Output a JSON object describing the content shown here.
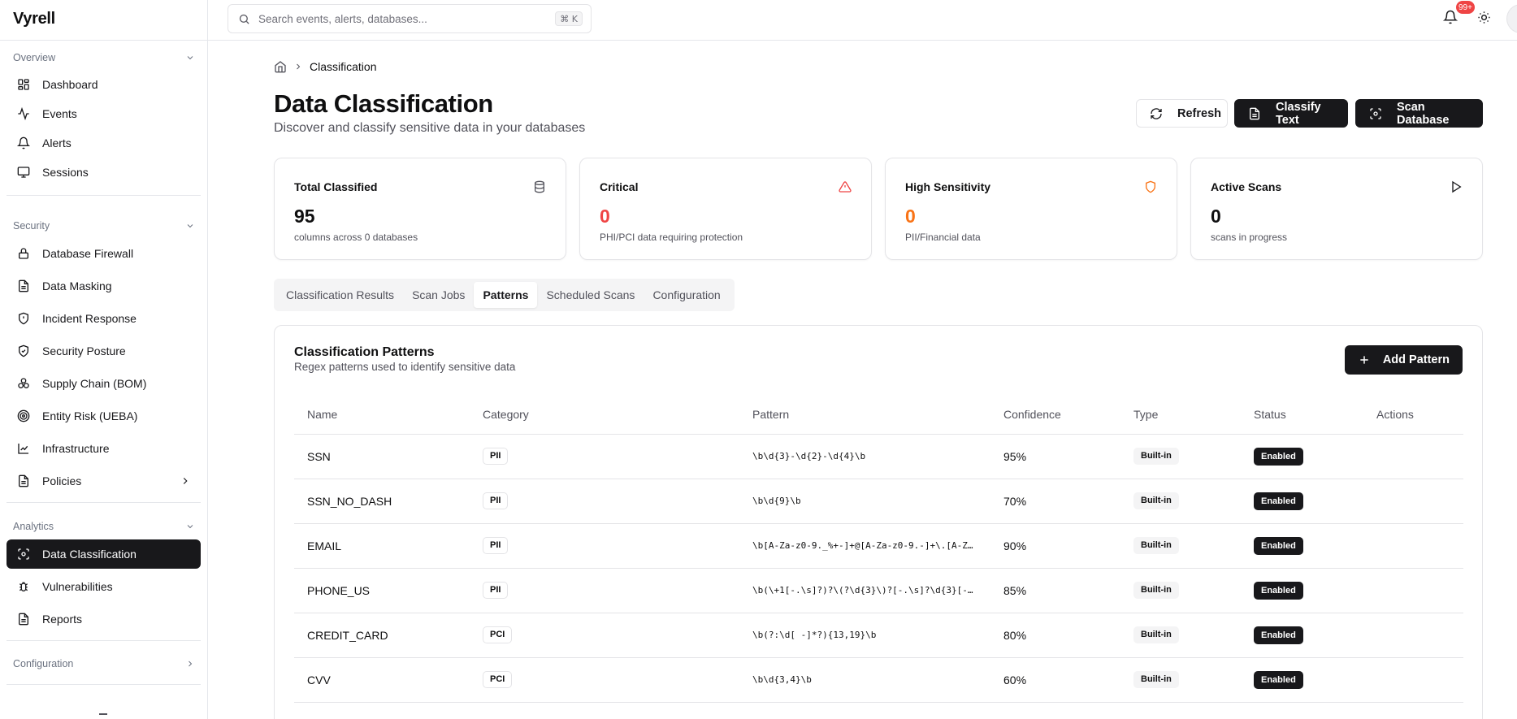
{
  "app": {
    "name": "Vyrell"
  },
  "search": {
    "placeholder": "Search events, alerts, databases...",
    "shortcut": "⌘ K"
  },
  "notifications": {
    "count": "99+"
  },
  "sidebar": {
    "sections": [
      {
        "title": "Overview"
      },
      {
        "title": "Security"
      },
      {
        "title": "Analytics"
      },
      {
        "title": "Configuration"
      }
    ],
    "items": [
      {
        "label": "Dashboard",
        "icon": "dashboard-icon"
      },
      {
        "label": "Events",
        "icon": "activity-icon"
      },
      {
        "label": "Alerts",
        "icon": "bell-icon"
      },
      {
        "label": "Sessions",
        "icon": "monitor-icon"
      },
      {
        "label": "Database Firewall",
        "icon": "lock-icon"
      },
      {
        "label": "Data Masking",
        "icon": "file-icon"
      },
      {
        "label": "Incident Response",
        "icon": "shield-alert-icon"
      },
      {
        "label": "Security Posture",
        "icon": "shield-check-icon"
      },
      {
        "label": "Supply Chain (BOM)",
        "icon": "boxes-icon"
      },
      {
        "label": "Entity Risk (UEBA)",
        "icon": "radar-icon"
      },
      {
        "label": "Infrastructure",
        "icon": "chart-icon"
      },
      {
        "label": "Policies",
        "icon": "file-icon"
      },
      {
        "label": "Data Classification",
        "icon": "scan-icon"
      },
      {
        "label": "Vulnerabilities",
        "icon": "bug-icon"
      },
      {
        "label": "Reports",
        "icon": "file-icon"
      }
    ],
    "active": "Data Classification"
  },
  "breadcrumb": {
    "current": "Classification"
  },
  "page": {
    "title": "Data Classification",
    "subtitle": "Discover and classify sensitive data in your databases"
  },
  "actions": {
    "refresh": "Refresh",
    "classify": "Classify Text",
    "scan": "Scan Database"
  },
  "stats": [
    {
      "title": "Total Classified",
      "value": "95",
      "desc": "columns across 0 databases",
      "icon": "database-icon",
      "color": "#18181b"
    },
    {
      "title": "Critical",
      "value": "0",
      "desc": "PHI/PCI data requiring protection",
      "icon": "alert-triangle-icon",
      "color": "#ef4444"
    },
    {
      "title": "High Sensitivity",
      "value": "0",
      "desc": "PII/Financial data",
      "icon": "shield-icon",
      "color": "#f97316"
    },
    {
      "title": "Active Scans",
      "value": "0",
      "desc": "scans in progress",
      "icon": "play-icon",
      "color": "#18181b"
    }
  ],
  "tabs": [
    "Classification Results",
    "Scan Jobs",
    "Patterns",
    "Scheduled Scans",
    "Configuration"
  ],
  "active_tab": "Patterns",
  "patterns": {
    "title": "Classification Patterns",
    "subtitle": "Regex patterns used to identify sensitive data",
    "add_label": "Add Pattern",
    "columns": [
      "Name",
      "Category",
      "Pattern",
      "Confidence",
      "Type",
      "Status",
      "Actions"
    ],
    "rows": [
      {
        "name": "SSN",
        "category": "PII",
        "pattern": "\\b\\d{3}-\\d{2}-\\d{4}\\b",
        "confidence": "95%",
        "type": "Built-in",
        "status": "Enabled"
      },
      {
        "name": "SSN_NO_DASH",
        "category": "PII",
        "pattern": "\\b\\d{9}\\b",
        "confidence": "70%",
        "type": "Built-in",
        "status": "Enabled"
      },
      {
        "name": "EMAIL",
        "category": "PII",
        "pattern": "\\b[A-Za-z0-9._%+-]+@[A-Za-z0-9.-]+\\.[A-Z…",
        "confidence": "90%",
        "type": "Built-in",
        "status": "Enabled"
      },
      {
        "name": "PHONE_US",
        "category": "PII",
        "pattern": "\\b(\\+1[-.\\s]?)?\\(?\\d{3}\\)?[-.\\s]?\\d{3}[-…",
        "confidence": "85%",
        "type": "Built-in",
        "status": "Enabled"
      },
      {
        "name": "CREDIT_CARD",
        "category": "PCI",
        "pattern": "\\b(?:\\d[ -]*?){13,19}\\b",
        "confidence": "80%",
        "type": "Built-in",
        "status": "Enabled"
      },
      {
        "name": "CVV",
        "category": "PCI",
        "pattern": "\\b\\d{3,4}\\b",
        "confidence": "60%",
        "type": "Built-in",
        "status": "Enabled"
      }
    ]
  }
}
